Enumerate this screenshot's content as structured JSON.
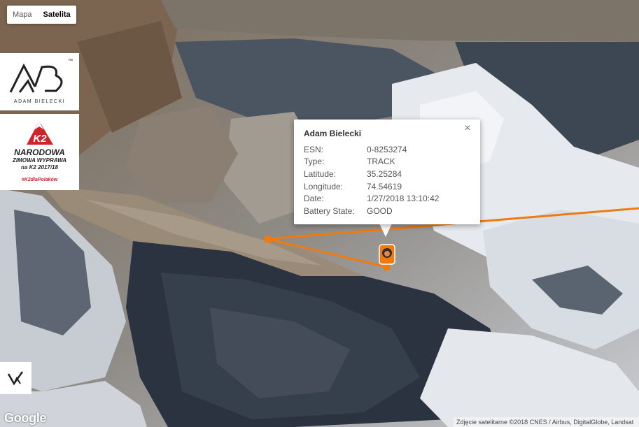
{
  "map": {
    "view": "satellite",
    "map_type_control": {
      "options": [
        "Mapa",
        "Satelita"
      ],
      "selected": "Satelita"
    },
    "route_color": "#f07a0c",
    "google_logo": "Google",
    "attribution": "Zdjęcie satelitarne ©2018 CNES / Airbus, DigitalGlobe, Landsat"
  },
  "branding": {
    "adam_bielecki_logo": {
      "tm": "™",
      "caption": "ADAM BIELECKI"
    },
    "k2_logo": {
      "mark": "K2",
      "line1": "NARODOWA",
      "line2": "ZIMOWA WYPRAWA",
      "line3": "na K2 2017/18",
      "hashtag": "#K2dlaPolaków",
      "accent_color": "#d1232a"
    },
    "bottom_icon": "brand-mark-icon"
  },
  "popup": {
    "title": "Adam Bielecki",
    "close_icon": "close-icon",
    "rows": [
      {
        "label": "ESN:",
        "value": "0-8253274"
      },
      {
        "label": "Type:",
        "value": "TRACK"
      },
      {
        "label": "Latitude:",
        "value": "35.25284"
      },
      {
        "label": "Longitude:",
        "value": "74.54619"
      },
      {
        "label": "Date:",
        "value": "1/27/2018 13:10:42"
      },
      {
        "label": "Battery State:",
        "value": "GOOD"
      }
    ]
  },
  "marker": {
    "icon": "climber-avatar-icon"
  }
}
